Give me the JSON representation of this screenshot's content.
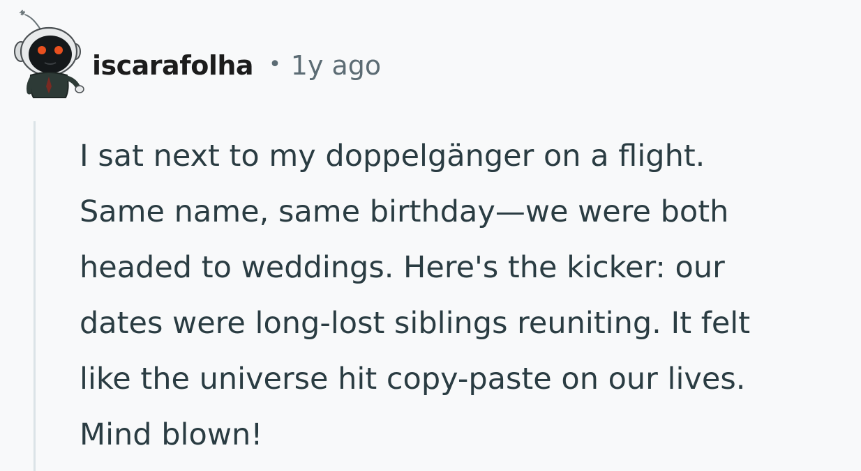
{
  "comment": {
    "username": "iscarafolha",
    "separator": "•",
    "timestamp": "1y ago",
    "avatar_icon": "snoo-avatar-icon",
    "body": "I sat next to my doppelgänger on a flight.\nSame name, same birthday—we were both\nheaded to weddings. Here's the kicker: our\ndates were long-lost siblings reuniting. It felt\nlike the universe hit copy-paste on our lives.\nMind blown!"
  },
  "colors": {
    "background": "#f8f9fa",
    "username": "#1c1c1c",
    "meta": "#5c6c74",
    "body_text": "#2a3c42",
    "thread_line": "#dbe3e7",
    "avatar_eyes": "#e8501f"
  }
}
